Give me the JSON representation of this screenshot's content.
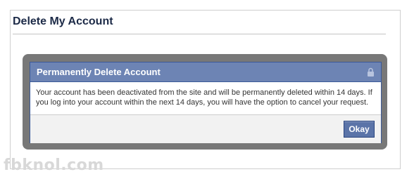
{
  "page": {
    "title": "Delete My Account"
  },
  "dialog": {
    "title": "Permanently Delete Account",
    "message": "Your account has been deactivated from the site and will be permanently deleted within 14 days. If you log into your account within the next 14 days, you will have the option to cancel your request.",
    "okay_label": "Okay",
    "header_color": "#6d84b4",
    "button_color": "#5b74a8",
    "lock_icon": "lock-icon"
  },
  "watermark": {
    "text": "fbknol.com"
  }
}
